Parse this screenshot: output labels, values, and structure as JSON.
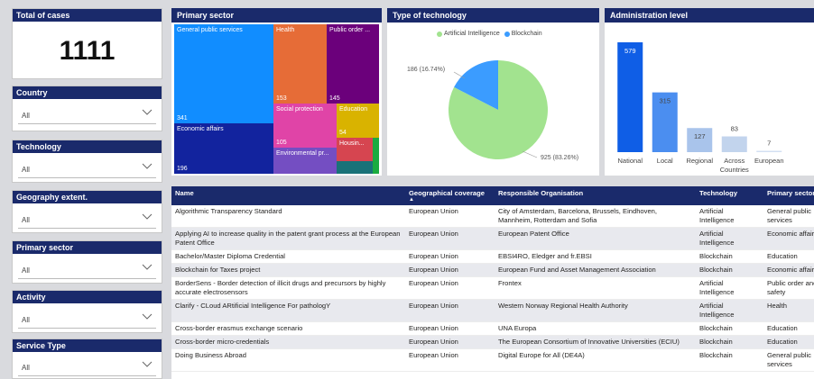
{
  "total": {
    "title": "Total of cases",
    "value": "1111"
  },
  "filters": [
    {
      "title": "Country",
      "value": "All"
    },
    {
      "title": "Technology",
      "value": "All"
    },
    {
      "title": "Geography extent.",
      "value": "All"
    },
    {
      "title": "Primary sector",
      "value": "All"
    },
    {
      "title": "Activity",
      "value": "All"
    },
    {
      "title": "Service Type",
      "value": "All"
    }
  ],
  "treemap": {
    "title": "Primary sector",
    "tiles": [
      {
        "label": "General public services",
        "value": "341",
        "color": "#118dff"
      },
      {
        "label": "Health",
        "value": "153",
        "color": "#e66c37"
      },
      {
        "label": "Public order ...",
        "value": "145",
        "color": "#6b007b"
      },
      {
        "label": "Economic affairs",
        "value": "196",
        "color": "#12239e"
      },
      {
        "label": "Social protection",
        "value": "105",
        "color": "#e044a7"
      },
      {
        "label": "Education",
        "value": "54",
        "color": "#d9b300"
      },
      {
        "label": "Environmental pr...",
        "value": "",
        "color": "#744ec2"
      },
      {
        "label": "Housin...",
        "value": "",
        "color": "#d64550"
      },
      {
        "label": "",
        "value": "",
        "color": "#197278"
      },
      {
        "label": "",
        "value": "",
        "color": "#1aab40"
      }
    ]
  },
  "pie": {
    "title": "Type of technology",
    "legend": [
      {
        "label": "Artificial Intelligence",
        "color": "#a2e38f"
      },
      {
        "label": "Blockchain",
        "color": "#3b9cff"
      }
    ],
    "label_small": "186 (16.74%)",
    "label_large": "925 (83.26%)"
  },
  "chart_data": {
    "type": "bar",
    "title": "Administration level",
    "categories": [
      "National",
      "Local",
      "Regional",
      "Across Countries",
      "European"
    ],
    "category_lines": [
      [
        "National"
      ],
      [
        "Local"
      ],
      [
        "Regional"
      ],
      [
        "Across",
        "Countries"
      ],
      [
        "European"
      ]
    ],
    "values": [
      579,
      315,
      127,
      83,
      7
    ],
    "colors": [
      "#0f5ee6",
      "#4b8ef0",
      "#a9c4eb",
      "#c2d4ed",
      "#d3dff2"
    ]
  },
  "table": {
    "columns": [
      "Name",
      "Geographical coverage",
      "Responsible Organisation",
      "Technology",
      "Primary sector"
    ],
    "sort_indicator": "▲",
    "rows": [
      [
        "Algorithmic Transparency Standard",
        "European Union",
        "City of Amsterdam, Barcelona, Brussels, Eindhoven, Mannheim, Rotterdam and Sofia",
        "Artificial Intelligence",
        "General public services"
      ],
      [
        "Applying AI to increase quality in the patent grant process at the European Patent Office",
        "European Union",
        "European Patent Office",
        "Artificial Intelligence",
        "Economic affairs"
      ],
      [
        "Bachelor/Master Diploma Credential",
        "European Union",
        "EBSI4RO, Eledger and fr.EBSI",
        "Blockchain",
        "Education"
      ],
      [
        "Blockchain for Taxes project",
        "European Union",
        "European Fund and Asset Management Association",
        "Blockchain",
        "Economic affairs"
      ],
      [
        "BorderSens - Border detection of illicit drugs and precursors by highly accurate electrosensors",
        "European Union",
        "Frontex",
        "Artificial Intelligence",
        "Public order and safety"
      ],
      [
        "Clarify - CLoud ARtificial Intelligence For pathologY",
        "European Union",
        "Western Norway Regional Health Authority",
        "Artificial Intelligence",
        "Health"
      ],
      [
        "Cross-border erasmus exchange scenario",
        "European Union",
        "UNA Europa",
        "Blockchain",
        "Education"
      ],
      [
        "Cross-border micro-credentials",
        "European Union",
        "The European Consortium of Innovative Universities (ECIU)",
        "Blockchain",
        "Education"
      ],
      [
        "Doing Business Abroad",
        "European Union",
        "Digital Europe for All (DE4A)",
        "Blockchain",
        "General public services"
      ]
    ]
  }
}
